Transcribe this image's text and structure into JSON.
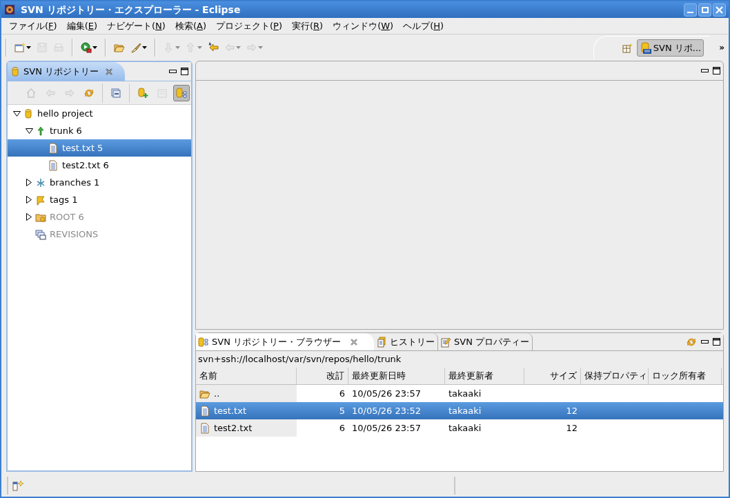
{
  "window": {
    "title": "SVN リポジトリー・エクスプローラー - Eclipse"
  },
  "menu": [
    {
      "before": "ファイル(",
      "key": "F",
      "after": ")"
    },
    {
      "before": "編集(",
      "key": "E",
      "after": ")"
    },
    {
      "before": "ナビゲート(",
      "key": "N",
      "after": ")"
    },
    {
      "before": "検索(",
      "key": "A",
      "after": ")"
    },
    {
      "before": "プロジェクト(",
      "key": "P",
      "after": ")"
    },
    {
      "before": "実行(",
      "key": "R",
      "after": ")"
    },
    {
      "before": "ウィンドウ(",
      "key": "W",
      "after": ")"
    },
    {
      "before": "ヘルプ(",
      "key": "H",
      "after": ")"
    }
  ],
  "toolbar": [
    {
      "kind": "new",
      "dropdown": true,
      "disabled": false
    },
    {
      "kind": "save",
      "dropdown": false,
      "disabled": true
    },
    {
      "kind": "print",
      "dropdown": false,
      "disabled": true
    },
    {
      "kind": "separator"
    },
    {
      "kind": "run",
      "dropdown": true,
      "disabled": false
    },
    {
      "kind": "separator"
    },
    {
      "kind": "open",
      "dropdown": false,
      "disabled": false
    },
    {
      "kind": "brush",
      "dropdown": true,
      "disabled": false
    },
    {
      "kind": "separator"
    },
    {
      "kind": "down",
      "dropdown": true,
      "disabled": true
    },
    {
      "kind": "up",
      "dropdown": true,
      "disabled": true
    },
    {
      "kind": "last-edit",
      "dropdown": false,
      "disabled": false
    },
    {
      "kind": "back",
      "dropdown": true,
      "disabled": true
    },
    {
      "kind": "forward",
      "dropdown": true,
      "disabled": true
    }
  ],
  "perspective": {
    "label": "SVN リポ...",
    "selected": true
  },
  "overflow_button": "»",
  "repositories_view": {
    "title": "SVN リポジトリー",
    "toolbar": [
      {
        "kind": "home",
        "disabled": true,
        "selected": false
      },
      {
        "kind": "back",
        "disabled": true,
        "selected": false
      },
      {
        "kind": "forward",
        "disabled": true,
        "selected": false
      },
      {
        "kind": "refresh",
        "disabled": false,
        "selected": false
      },
      {
        "kind": "separator"
      },
      {
        "kind": "collapse",
        "disabled": false,
        "selected": false
      },
      {
        "kind": "separator"
      },
      {
        "kind": "add-repo",
        "disabled": false,
        "selected": false
      },
      {
        "kind": "svn-new",
        "disabled": true,
        "selected": false
      },
      {
        "kind": "layout",
        "disabled": false,
        "selected": true
      }
    ],
    "tree": [
      {
        "label": "hello project",
        "kind": "repository",
        "expanded": true,
        "selected": false,
        "disabled": false,
        "children": [
          {
            "label": "trunk 6",
            "kind": "trunk",
            "expanded": true,
            "selected": false,
            "disabled": false,
            "children": [
              {
                "label": "test.txt 5",
                "kind": "file",
                "selected": true,
                "disabled": false
              },
              {
                "label": "test2.txt 6",
                "kind": "file",
                "selected": false,
                "disabled": false
              }
            ]
          },
          {
            "label": "branches 1",
            "kind": "branches",
            "expanded": false,
            "selected": false,
            "disabled": false
          },
          {
            "label": "tags 1",
            "kind": "tags",
            "expanded": false,
            "selected": false,
            "disabled": false
          },
          {
            "label": "ROOT 6",
            "kind": "root",
            "expanded": false,
            "selected": false,
            "disabled": true
          },
          {
            "label": "REVISIONS",
            "kind": "revisions",
            "selected": false,
            "disabled": true
          }
        ]
      }
    ]
  },
  "bottom_view": {
    "tabs": [
      {
        "label": "SVN リポジトリー・ブラウザー",
        "kind": "browser",
        "selected": true
      },
      {
        "label": "ヒストリー",
        "kind": "history",
        "selected": false
      },
      {
        "label": "SVN プロパティー",
        "kind": "properties",
        "selected": false
      }
    ],
    "path": "svn+ssh://localhost/var/svn/repos/hello/trunk",
    "table": {
      "columns": [
        "名前",
        "改訂",
        "最終更新日時",
        "最終更新者",
        "サイズ",
        "保持プロパティ",
        "ロック所有者"
      ],
      "rows": [
        {
          "kind": "folder",
          "cells": [
            "..",
            "6",
            "10/05/26 23:57",
            "takaaki",
            "",
            "",
            ""
          ],
          "selected": false
        },
        {
          "kind": "file",
          "cells": [
            "test.txt",
            "5",
            "10/05/26 23:52",
            "takaaki",
            "12",
            "",
            ""
          ],
          "selected": true
        },
        {
          "kind": "file",
          "cells": [
            "test2.txt",
            "6",
            "10/05/26 23:57",
            "takaaki",
            "12",
            "",
            ""
          ],
          "selected": false
        }
      ]
    }
  }
}
